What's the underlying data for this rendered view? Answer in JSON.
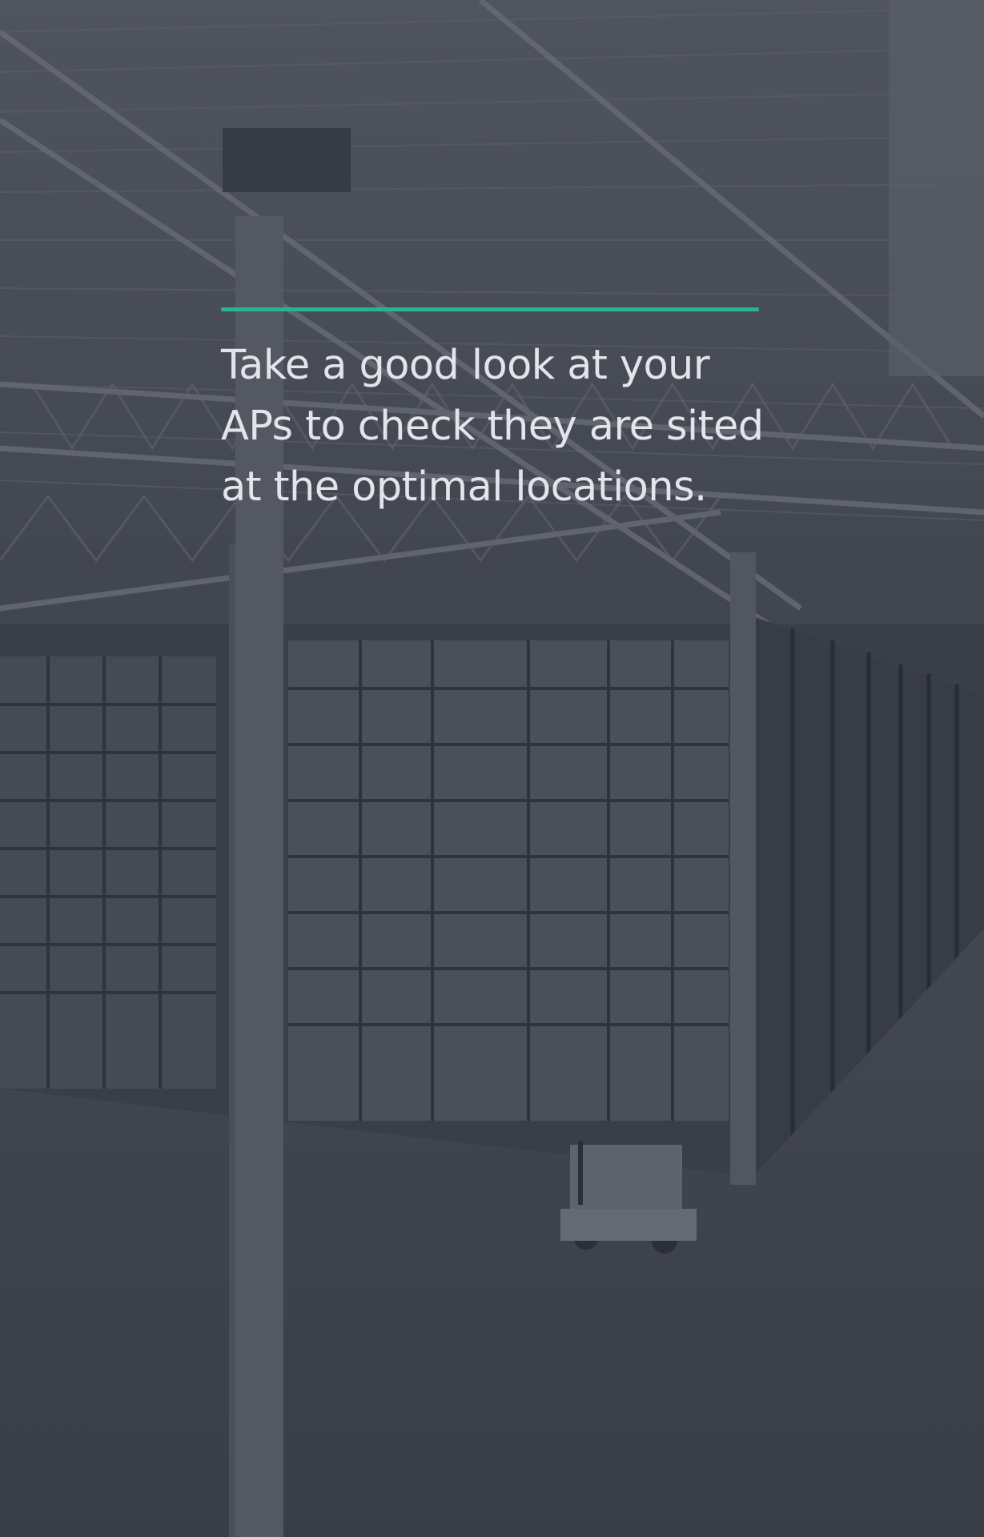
{
  "colors": {
    "accent": "#27b58b",
    "overlay": "#3e424c",
    "text": "#e4e5ea"
  },
  "background": {
    "image_subject": "warehouse interior with tall pallet racks, roof trusses and a forklift",
    "icon": "warehouse-photo"
  },
  "caption": {
    "line1": "Take a good look at your",
    "line2": "APs to check they are sited",
    "line3": "at the optimal locations."
  }
}
